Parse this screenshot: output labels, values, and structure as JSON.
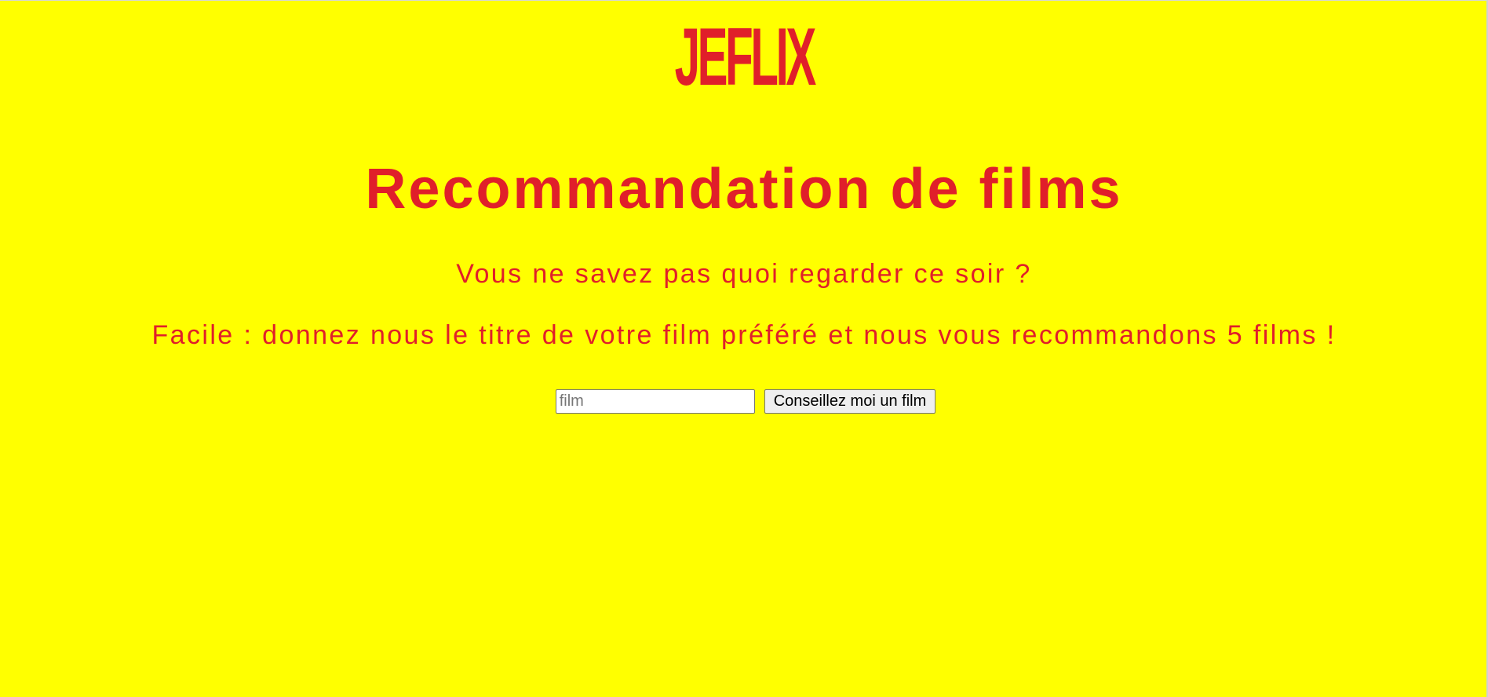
{
  "header": {
    "logo_text": "JEFLIX"
  },
  "main": {
    "title": "Recommandation de films",
    "subtitle": "Vous ne savez pas quoi regarder ce soir ?",
    "instructions": "Facile : donnez nous le titre de votre film préféré et nous vous recommandons 5 films !"
  },
  "form": {
    "film_input": {
      "value": "",
      "placeholder": "film"
    },
    "submit_label": "Conseillez moi un film"
  },
  "colors": {
    "background": "#ffff00",
    "brand_red": "#e01f2a"
  }
}
